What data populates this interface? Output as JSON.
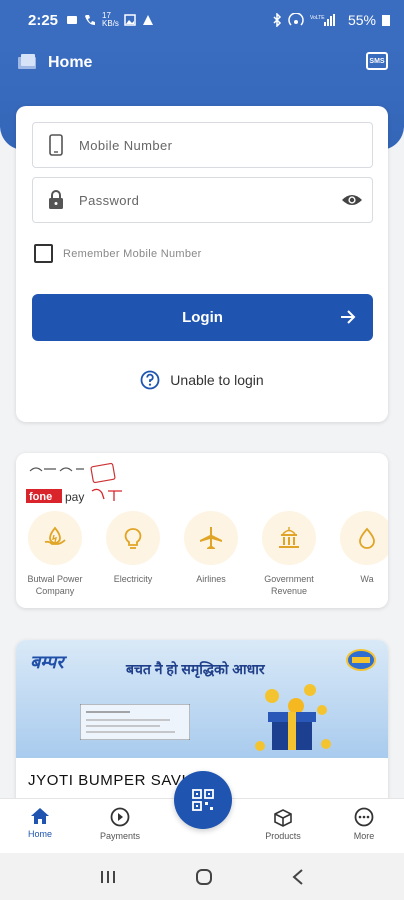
{
  "status_bar": {
    "time": "2:25",
    "data_speed": "17 KB/s",
    "battery": "55%"
  },
  "header": {
    "title": "Home"
  },
  "login": {
    "mobile_placeholder": "Mobile Number",
    "password_placeholder": "Password",
    "remember_label": "Remember Mobile Number",
    "login_button": "Login",
    "unable_label": "Unable to login"
  },
  "fonepay": {
    "services": [
      {
        "label": "Butwal Power Company",
        "icon": "power-hand-icon"
      },
      {
        "label": "Electricity",
        "icon": "bulb-icon"
      },
      {
        "label": "Airlines",
        "icon": "airplane-icon"
      },
      {
        "label": "Government Revenue",
        "icon": "government-building-icon"
      },
      {
        "label": "Wa",
        "icon": "water-drop-icon"
      }
    ]
  },
  "banner": {
    "logo_text": "बम्पर",
    "tagline": "बचत नै हो समृद्धिको आधार",
    "title": "JYOTI BUMPER SAVI"
  },
  "bottom_nav": {
    "items": [
      {
        "label": "Home",
        "icon": "home-icon",
        "active": true
      },
      {
        "label": "Payments",
        "icon": "payments-icon",
        "active": false
      },
      {
        "label": "Products",
        "icon": "products-icon",
        "active": false
      },
      {
        "label": "More",
        "icon": "more-icon",
        "active": false
      }
    ]
  },
  "colors": {
    "primary": "#1f55b0",
    "header": "#3a6cc0",
    "service_circle": "#fdf4e3",
    "service_icon": "#e0a526"
  }
}
